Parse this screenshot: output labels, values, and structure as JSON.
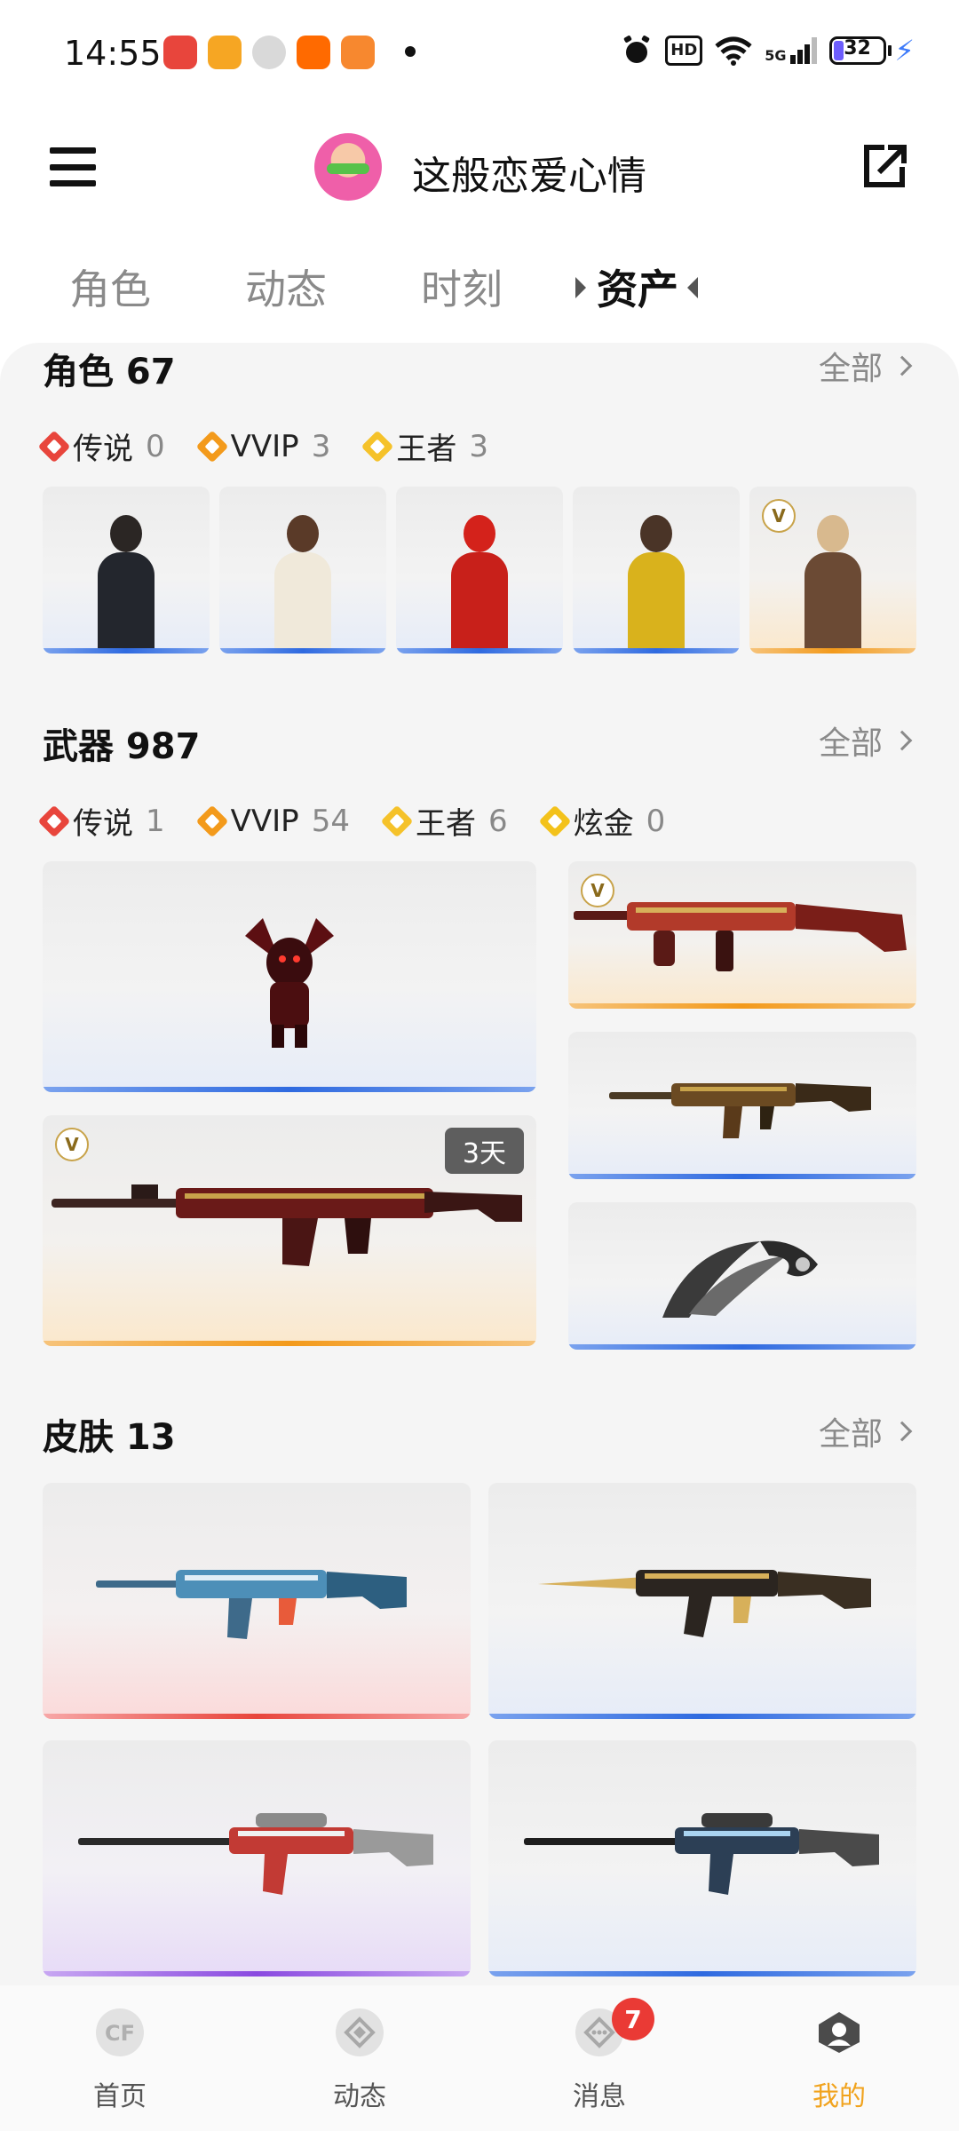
{
  "status_bar": {
    "time": "14:55",
    "hd": "HD",
    "network": "5G",
    "battery": "32"
  },
  "header": {
    "profile_name": "这般恋爱心情"
  },
  "tabs": [
    {
      "label": "角色",
      "active": false
    },
    {
      "label": "动态",
      "active": false
    },
    {
      "label": "时刻",
      "active": false
    },
    {
      "label": "资产",
      "active": true
    }
  ],
  "sections": {
    "roles": {
      "title": "角色 67",
      "all_label": "全部",
      "badges": [
        {
          "label": "传说",
          "count": "0"
        },
        {
          "label": "VVIP",
          "count": "3"
        },
        {
          "label": "王者",
          "count": "3"
        }
      ]
    },
    "weapons": {
      "title": "武器 987",
      "all_label": "全部",
      "badges": [
        {
          "label": "传说",
          "count": "1"
        },
        {
          "label": "VVIP",
          "count": "54"
        },
        {
          "label": "王者",
          "count": "6"
        },
        {
          "label": "炫金",
          "count": "0"
        }
      ],
      "timer_label": "3天"
    },
    "skins": {
      "title": "皮肤 13",
      "all_label": "全部"
    }
  },
  "bottom_nav": [
    {
      "label": "首页",
      "active": false
    },
    {
      "label": "动态",
      "active": false
    },
    {
      "label": "消息",
      "active": false,
      "badge": "7"
    },
    {
      "label": "我的",
      "active": true
    }
  ],
  "colors": {
    "accent_active_nav": "#f1a31d",
    "legend": "#e8453c",
    "vvip": "#f39a1b",
    "king": "#f5c22a",
    "notification": "#ea3a35"
  }
}
